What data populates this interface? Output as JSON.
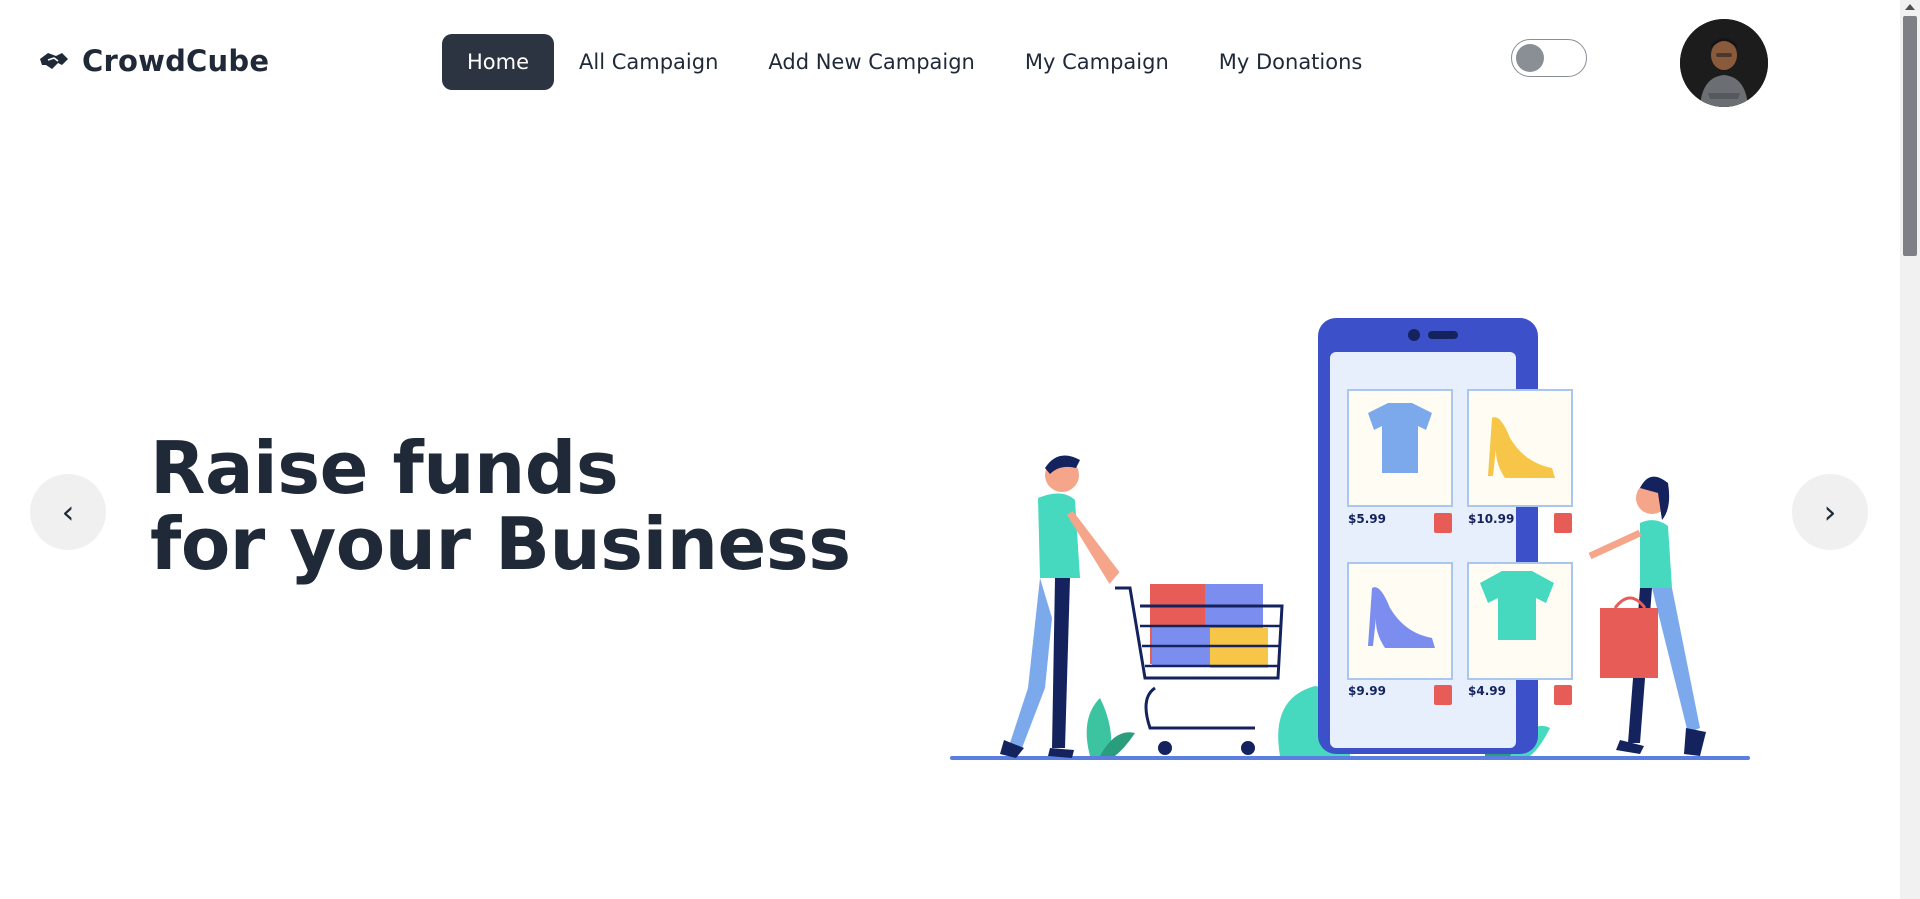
{
  "brand": {
    "name": "CrowdCube",
    "icon": "handshake-icon"
  },
  "nav": {
    "items": [
      {
        "label": "Home",
        "active": true
      },
      {
        "label": "All Campaign",
        "active": false
      },
      {
        "label": "Add New Campaign",
        "active": false
      },
      {
        "label": "My Campaign",
        "active": false
      },
      {
        "label": "My Donations",
        "active": false
      }
    ]
  },
  "theme_toggle": {
    "state": "off"
  },
  "hero": {
    "title_line1": "Raise funds",
    "title_line2": "for your Business",
    "prev_label": "‹",
    "next_label": "›"
  },
  "products": [
    {
      "price": "$5.99",
      "item": "t-shirt"
    },
    {
      "price": "$10.99",
      "item": "heel"
    },
    {
      "price": "$9.99",
      "item": "heel"
    },
    {
      "price": "$4.99",
      "item": "t-shirt"
    }
  ],
  "colors": {
    "accent_dark": "#2b3440",
    "text": "#1f2937",
    "phone_blue": "#3b50c9",
    "teal": "#46d9bf",
    "coral": "#e85c57",
    "periwinkle": "#7b8ef0",
    "yellow": "#f7c548"
  }
}
